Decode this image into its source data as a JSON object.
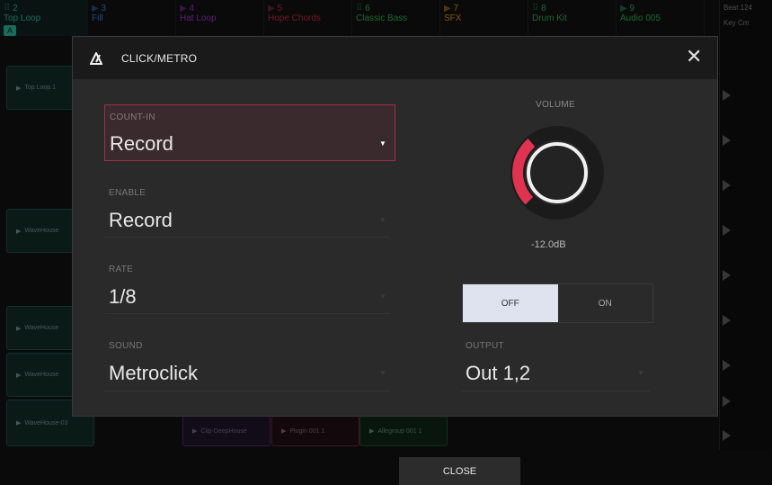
{
  "tracks": [
    {
      "num": "2",
      "name": "Top Loop",
      "badge": "A",
      "color": "#2aa58e"
    },
    {
      "num": "3",
      "name": "Fill",
      "color": "#2f74c0"
    },
    {
      "num": "4",
      "name": "Hat Loop",
      "color": "#8e2fb0"
    },
    {
      "num": "5",
      "name": "Hope Chords",
      "color": "#b0223a"
    },
    {
      "num": "6",
      "name": "Classic Bass",
      "color": "#2aa04a"
    },
    {
      "num": "7",
      "name": "SFX",
      "color": "#c58a1a"
    },
    {
      "num": "8",
      "name": "Drum Kit",
      "color": "#2aa04a"
    },
    {
      "num": "9",
      "name": "Audio 005",
      "color": "#2aa04a"
    }
  ],
  "side": {
    "tempo": "Beat 124",
    "key": "Key Cm"
  },
  "clips": [
    {
      "label": "Top Loop 1"
    },
    {
      "label": "WaveHouse"
    },
    {
      "label": "WaveHouse"
    },
    {
      "label": "WaveHouse"
    },
    {
      "label": "WaveHouse-03"
    },
    {
      "label": "Clip-DeepHouse"
    },
    {
      "label": "Plugin 001 1"
    },
    {
      "label": "Allegroup 001 1"
    }
  ],
  "dialog": {
    "title": "CLICK/METRO",
    "close_icon": "close-icon",
    "count_in": {
      "label": "COUNT-IN",
      "value": "Record"
    },
    "enable": {
      "label": "ENABLE",
      "value": "Record"
    },
    "rate": {
      "label": "RATE",
      "value": "1/8"
    },
    "sound": {
      "label": "SOUND",
      "value": "Metroclick"
    },
    "output": {
      "label": "OUTPUT",
      "value": "Out 1,2"
    },
    "volume": {
      "label": "VOLUME",
      "value": "-12.0dB",
      "level": 0.35
    },
    "toggle": {
      "off": "OFF",
      "on": "ON",
      "selected": "OFF"
    }
  },
  "footer": {
    "close": "CLOSE"
  },
  "colors": {
    "accent": "#e0334f",
    "active_border": "#9b3047"
  }
}
